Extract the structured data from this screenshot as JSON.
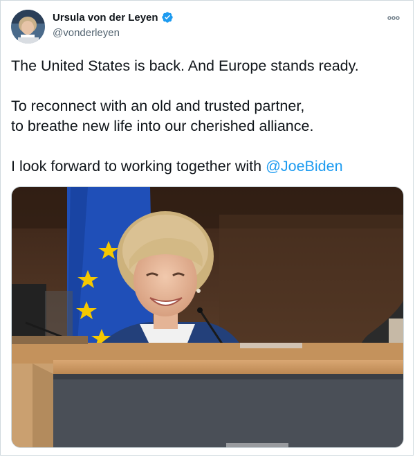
{
  "author": {
    "name": "Ursula von der Leyen",
    "handle": "@vonderleyen",
    "verified": true,
    "verified_icon": "verified-badge-icon"
  },
  "tweet": {
    "line1": "The United States is back. And Europe stands ready.",
    "line2": "To reconnect with an old and trusted partner,",
    "line3": "to breathe new life into our cherished alliance.",
    "line4_prefix": "I look forward to working together with ",
    "mention": "@JoeBiden"
  },
  "more_icon": "more-horizontal-icon",
  "colors": {
    "accent": "#1d9bf0",
    "text": "#0f1419",
    "secondary": "#536471"
  }
}
